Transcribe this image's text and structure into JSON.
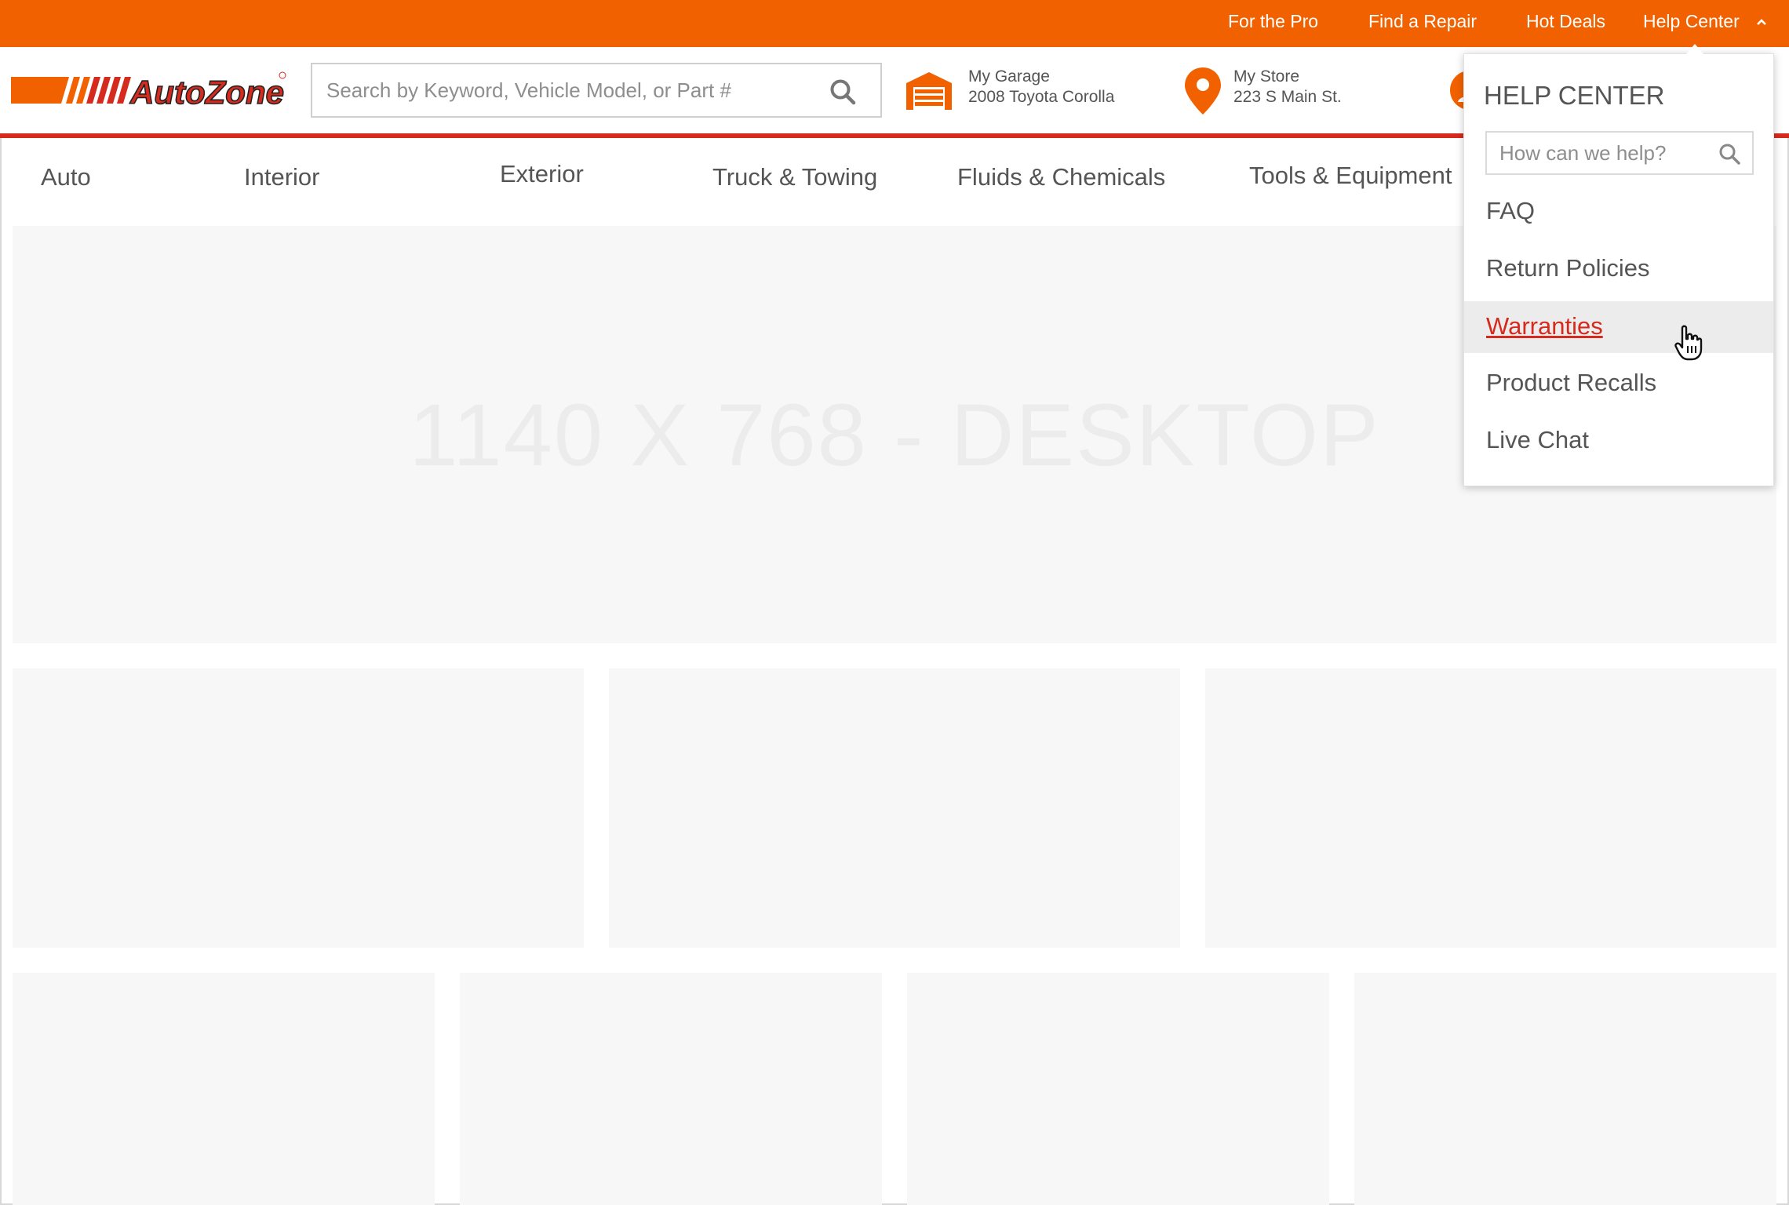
{
  "topbar": {
    "links": [
      "For the Pro",
      "Find a Repair",
      "Hot Deals",
      "Help Center"
    ]
  },
  "header": {
    "logo_text": "AutoZone",
    "search": {
      "placeholder": "Search by Keyword, Vehicle Model, or Part #"
    },
    "garage": {
      "label": "My Garage",
      "value": "2008 Toyota Corolla"
    },
    "store": {
      "label": "My Store",
      "value": "223 S Main St."
    }
  },
  "nav": {
    "items": [
      "Auto",
      "Interior",
      "Exterior",
      "Truck & Towing",
      "Fluids & Chemicals",
      "Tools & Equipment"
    ]
  },
  "hero": {
    "text": "1140 X 768 - DESKTOP"
  },
  "help_center": {
    "title": "HELP CENTER",
    "search_placeholder": "How can we help?",
    "items": [
      "FAQ",
      "Return Policies",
      "Warranties",
      "Product Recalls",
      "Live Chat"
    ],
    "hovered_item": "Warranties"
  },
  "colors": {
    "brand_orange": "#f26100",
    "brand_red": "#d52b1e",
    "placeholder_gray": "#f7f7f7"
  },
  "icons": [
    "search-icon",
    "garage-icon",
    "location-pin-icon",
    "account-icon",
    "chevron-up-icon",
    "hand-cursor-icon"
  ]
}
